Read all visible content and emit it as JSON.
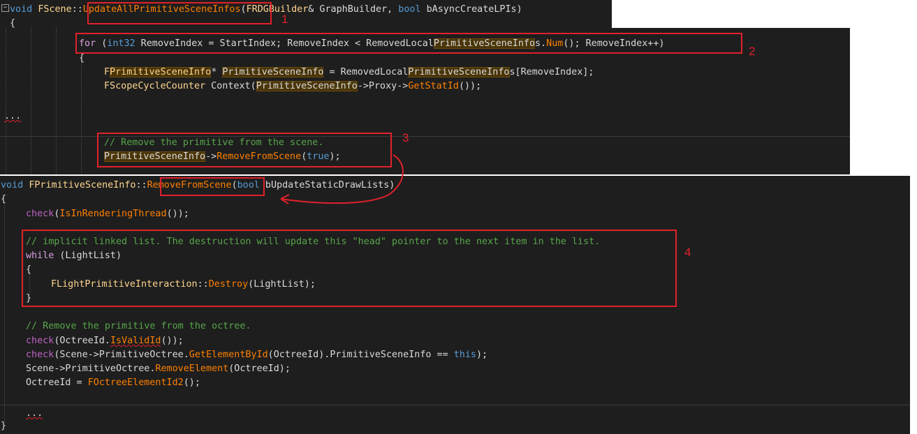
{
  "panel1": {
    "line1": {
      "kw_void": "void",
      "class": "FScene",
      "sep": "::",
      "func": "UpdateAllPrimitiveSceneInfos",
      "paren": "(",
      "p1type": "FRDGBuilder",
      "p1rest": "& GraphBuilder, ",
      "kw_bool": "bool",
      "p2rest": " bAsyncCreateLPIs)"
    },
    "line2": "{"
  },
  "panel2": {
    "for_line": {
      "kw_for": "for",
      "open": " (",
      "kw_int": "int32",
      "mid1": " RemoveIndex = StartIndex; RemoveIndex < RemovedLocal",
      "hl": "PrimitiveSceneInfo",
      "mid2": "s.",
      "num": "Num",
      "tail": "(); RemoveIndex++)"
    },
    "brace_open": "{",
    "decl_line": {
      "type_a": "F",
      "type_hl": "PrimitiveSceneInfo",
      "star": "* ",
      "var_hl": "PrimitiveSceneInfo",
      "eq": " = RemovedLocal",
      "arr_hl": "PrimitiveSceneInfo",
      "tail": "s[RemoveIndex];"
    },
    "counter_line": {
      "type": "FScopeCycleCounter",
      "ctx": " Context(",
      "var_hl": "PrimitiveSceneInfo",
      "arrow": "->Proxy->",
      "fn": "GetStatId",
      "tail": "());"
    },
    "ellipsis": "...",
    "comment": "// Remove the primitive from the scene.",
    "remove_line": {
      "var_hl": "PrimitiveSceneInfo",
      "arrow": "->",
      "fn": "RemoveFromScene",
      "open": "(",
      "kw_true": "true",
      "close": ");"
    }
  },
  "panel3": {
    "sig": {
      "kw_void": "void",
      "class": "FPrimitiveSceneInfo",
      "sep": "::",
      "func": "RemoveFromScene",
      "open": "(",
      "kw_bool": "bool",
      "rest": " bUpdateStaticDrawLists)"
    },
    "brace_open": "{",
    "check_line": {
      "check": "check",
      "open": "(",
      "fn": "IsInRenderingThread",
      "tail": "());"
    },
    "comment1": "// implicit linked list. The destruction will update this \"head\" pointer to the next item in the list.",
    "while_line": {
      "kw": "while",
      "tail": " (LightList)"
    },
    "inner_open": "{",
    "destroy_line": {
      "type": "FLightPrimitiveInteraction",
      "sep": "::",
      "fn": "Destroy",
      "tail": "(LightList);"
    },
    "inner_close": "}",
    "comment2": "// Remove the primitive from the octree.",
    "valid_line": {
      "check": "check",
      "a": "(OctreeId.",
      "fn": "IsValidId",
      "tail": "());"
    },
    "get_line": {
      "check": "check",
      "a": "(Scene->PrimitiveOctree.",
      "fn": "GetElementById",
      "b": "(OctreeId).PrimitiveSceneInfo == ",
      "kw_this": "this",
      "tail": ");"
    },
    "remove_elem_line": {
      "a": "Scene->PrimitiveOctree.",
      "fn": "RemoveElement",
      "tail": "(OctreeId);"
    },
    "assign_line": {
      "a": "OctreeId = ",
      "type": "FOctreeElementId2",
      "tail": "();"
    },
    "ellipsis": "...",
    "brace_close": "}"
  },
  "annotations": [
    "1",
    "2",
    "3",
    "4"
  ],
  "colors": {
    "annotation_red": "#e0212b",
    "editor_bg": "#1e1e1e"
  }
}
